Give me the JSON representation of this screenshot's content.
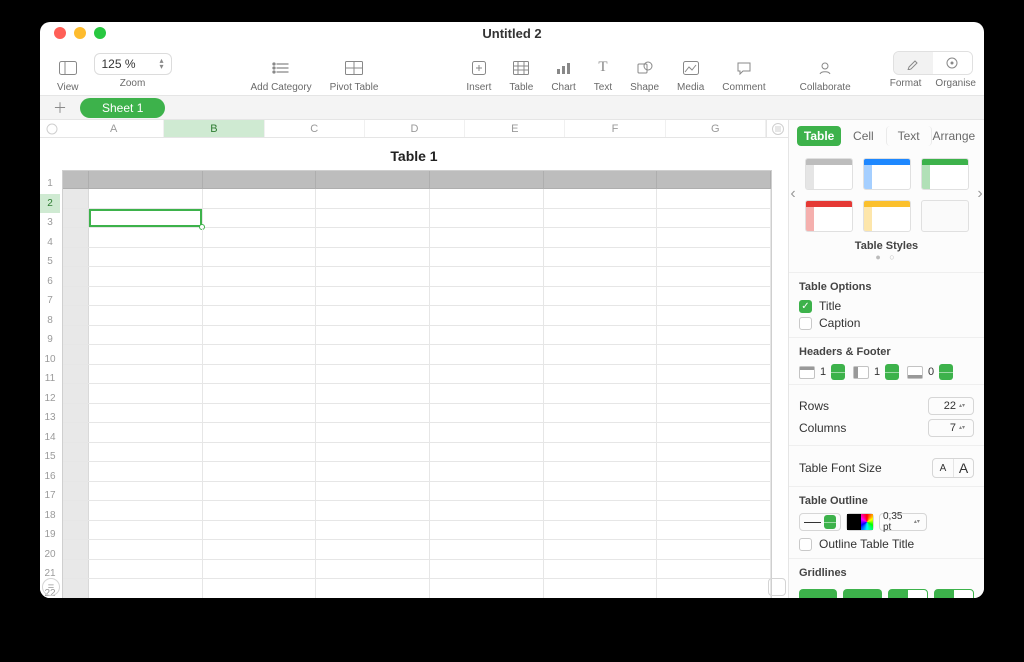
{
  "window": {
    "title": "Untitled 2"
  },
  "toolbar": {
    "view": "View",
    "zoom_label": "Zoom",
    "zoom_value": "125 %",
    "add_category": "Add Category",
    "pivot_table": "Pivot Table",
    "insert": "Insert",
    "table": "Table",
    "chart": "Chart",
    "text": "Text",
    "shape": "Shape",
    "media": "Media",
    "comment": "Comment",
    "collaborate": "Collaborate",
    "format": "Format",
    "organise": "Organise"
  },
  "sheets": {
    "active": "Sheet 1"
  },
  "table": {
    "title": "Table 1",
    "columns": [
      "A",
      "B",
      "C",
      "D",
      "E",
      "F",
      "G"
    ],
    "active_col": "B",
    "row_count": 22,
    "active_row": 2
  },
  "inspector": {
    "tabs": {
      "table": "Table",
      "cell": "Cell",
      "text": "Text",
      "arrange": "Arrange"
    },
    "table_styles": "Table Styles",
    "table_options": "Table Options",
    "opt_title": "Title",
    "opt_caption": "Caption",
    "headers_footer": "Headers & Footer",
    "header_rows": "1",
    "header_cols": "1",
    "footer_rows": "0",
    "rows_label": "Rows",
    "rows_val": "22",
    "cols_label": "Columns",
    "cols_val": "7",
    "font_size_label": "Table Font Size",
    "outline_label": "Table Outline",
    "outline_pt": "0,35 pt",
    "outline_title": "Outline Table Title",
    "gridlines": "Gridlines"
  }
}
